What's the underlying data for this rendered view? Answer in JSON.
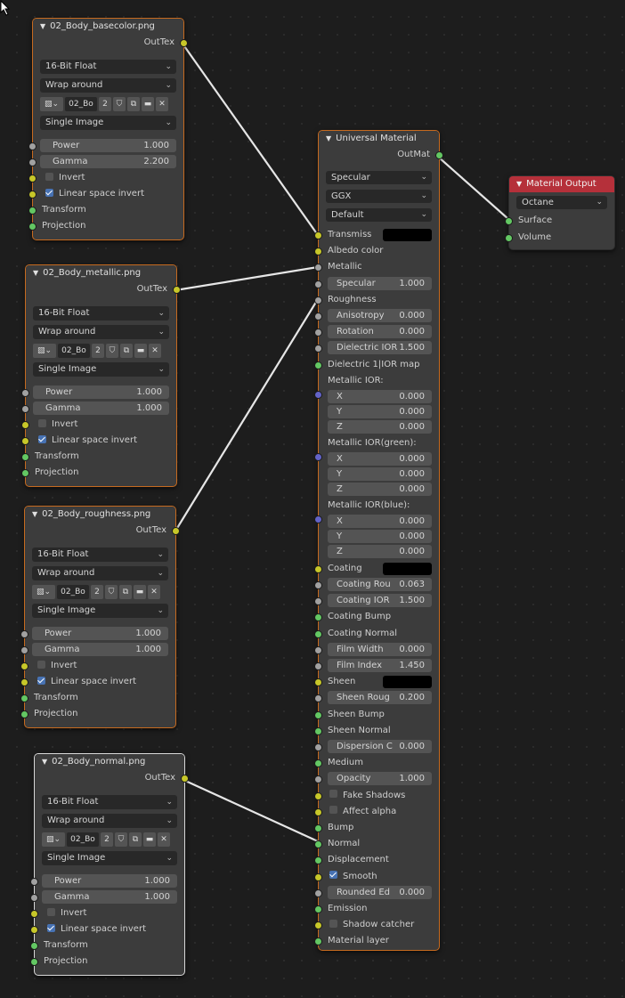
{
  "texture_nodes": [
    {
      "title": "02_Body_basecolor.png",
      "output": "OutTex",
      "bit_depth": "16-Bit Float",
      "wrap": "Wrap around",
      "image_name": "02_Bo",
      "user_count": "2",
      "source": "Single Image",
      "power_label": "Power",
      "power": "1.000",
      "gamma_label": "Gamma",
      "gamma": "2.200",
      "invert_label": "Invert",
      "invert_checked": false,
      "linear_label": "Linear space invert",
      "linear_checked": true,
      "transform": "Transform",
      "projection": "Projection"
    },
    {
      "title": "02_Body_metallic.png",
      "output": "OutTex",
      "bit_depth": "16-Bit Float",
      "wrap": "Wrap around",
      "image_name": "02_Bo",
      "user_count": "2",
      "source": "Single Image",
      "power_label": "Power",
      "power": "1.000",
      "gamma_label": "Gamma",
      "gamma": "1.000",
      "invert_label": "Invert",
      "invert_checked": false,
      "linear_label": "Linear space invert",
      "linear_checked": true,
      "transform": "Transform",
      "projection": "Projection"
    },
    {
      "title": "02_Body_roughness.png",
      "output": "OutTex",
      "bit_depth": "16-Bit Float",
      "wrap": "Wrap around",
      "image_name": "02_Bo",
      "user_count": "2",
      "source": "Single Image",
      "power_label": "Power",
      "power": "1.000",
      "gamma_label": "Gamma",
      "gamma": "1.000",
      "invert_label": "Invert",
      "invert_checked": false,
      "linear_label": "Linear space invert",
      "linear_checked": true,
      "transform": "Transform",
      "projection": "Projection"
    },
    {
      "title": "02_Body_normal.png",
      "output": "OutTex",
      "bit_depth": "16-Bit Float",
      "wrap": "Wrap around",
      "image_name": "02_Bo",
      "user_count": "2",
      "source": "Single Image",
      "power_label": "Power",
      "power": "1.000",
      "gamma_label": "Gamma",
      "gamma": "1.000",
      "invert_label": "Invert",
      "invert_checked": false,
      "linear_label": "Linear space invert",
      "linear_checked": true,
      "transform": "Transform",
      "projection": "Projection"
    }
  ],
  "universal_material": {
    "title": "Universal Material",
    "output": "OutMat",
    "mode": "Specular",
    "brdf": "GGX",
    "layer": "Default",
    "transmission": "Transmiss",
    "albedo": "Albedo color",
    "metallic": "Metallic",
    "specular_label": "Specular",
    "specular": "1.000",
    "roughness": "Roughness",
    "anisotropy_label": "Anisotropy",
    "anisotropy": "0.000",
    "rotation_label": "Rotation",
    "rotation": "0.000",
    "dielectric_ior_label": "Dielectric IOR",
    "dielectric_ior": "1.500",
    "dielectric_map": "Dielectric 1|IOR map",
    "metallic_ior": "Metallic IOR:",
    "metallic_ior_green": "Metallic IOR(green):",
    "metallic_ior_blue": "Metallic IOR(blue):",
    "x_label": "X",
    "y_label": "Y",
    "z_label": "Z",
    "zero": "0.000",
    "coating": "Coating",
    "coating_rough_label": "Coating Rou",
    "coating_rough": "0.063",
    "coating_ior_label": "Coating IOR",
    "coating_ior": "1.500",
    "coating_bump": "Coating Bump",
    "coating_normal": "Coating Normal",
    "film_width_label": "Film Width",
    "film_width": "0.000",
    "film_index_label": "Film Index",
    "film_index": "1.450",
    "sheen": "Sheen",
    "sheen_rough_label": "Sheen Roug",
    "sheen_rough": "0.200",
    "sheen_bump": "Sheen Bump",
    "sheen_normal": "Sheen Normal",
    "dispersion_label": "Dispersion C",
    "dispersion": "0.000",
    "medium": "Medium",
    "opacity_label": "Opacity",
    "opacity": "1.000",
    "fake_shadows": "Fake Shadows",
    "affect_alpha": "Affect alpha",
    "bump": "Bump",
    "normal": "Normal",
    "displacement": "Displacement",
    "smooth": "Smooth",
    "rounded_label": "Rounded Ed",
    "rounded": "0.000",
    "emission": "Emission",
    "shadow_catcher": "Shadow catcher",
    "material_layer": "Material layer"
  },
  "material_output": {
    "title": "Material Output",
    "target": "Octane",
    "surface": "Surface",
    "volume": "Volume"
  },
  "colors": {
    "node_border_selected": "#c66a1f",
    "material_output_header": "#b5303a",
    "link": "#e6e6e6"
  }
}
